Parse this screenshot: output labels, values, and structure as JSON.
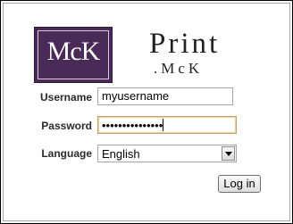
{
  "logo": {
    "text": "McK"
  },
  "brand": {
    "main": "Print",
    "sub": ".McK"
  },
  "form": {
    "username_label": "Username",
    "username_value": "myusername",
    "password_label": "Password",
    "password_masked": "•••••••••••••••",
    "language_label": "Language",
    "language_value": "English",
    "login_label": "Log in"
  },
  "colors": {
    "logo_bg": "#4a2a57",
    "focus_border": "#d0a15a"
  }
}
